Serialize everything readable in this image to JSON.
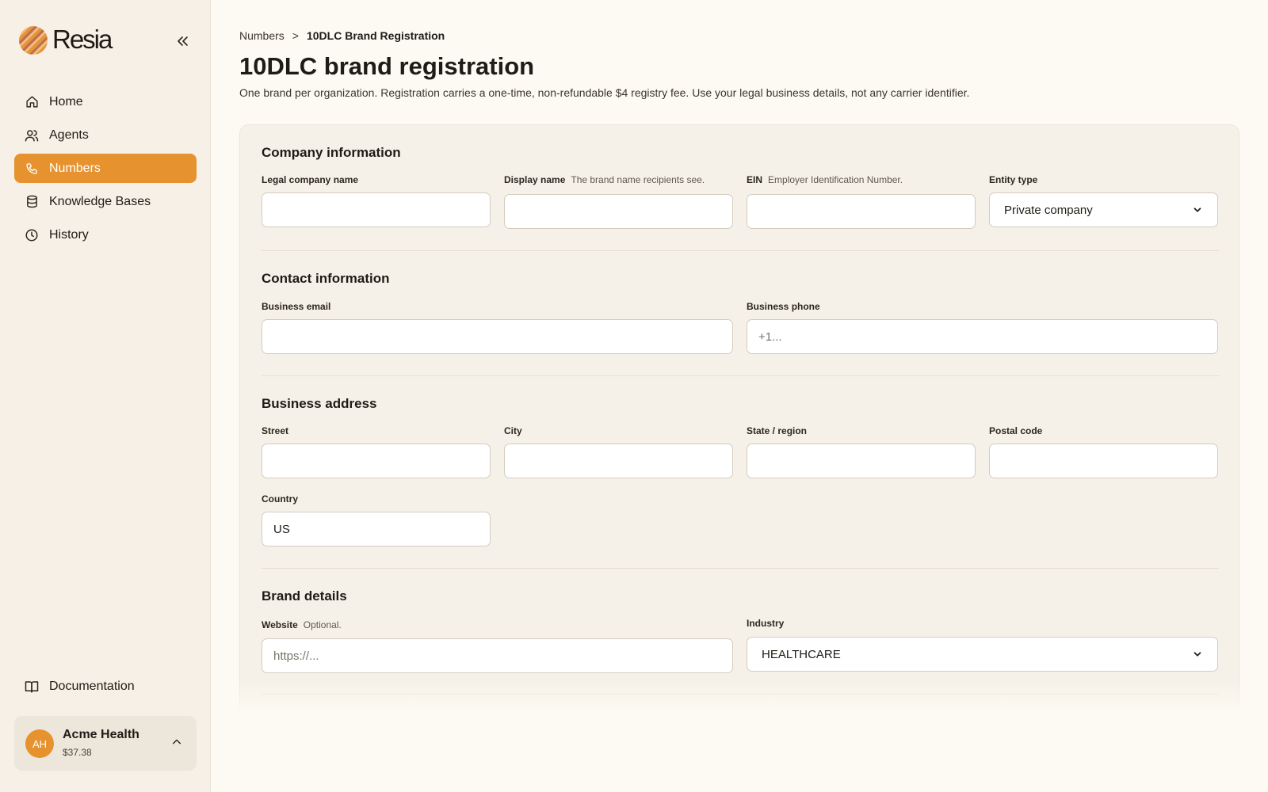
{
  "sidebar": {
    "logo_text": "Resia",
    "nav": [
      {
        "label": "Home",
        "icon": "home-icon"
      },
      {
        "label": "Agents",
        "icon": "users-icon"
      },
      {
        "label": "Numbers",
        "icon": "phone-icon",
        "active": true
      },
      {
        "label": "Knowledge Bases",
        "icon": "database-icon"
      },
      {
        "label": "History",
        "icon": "clock-icon"
      }
    ],
    "documentation_label": "Documentation",
    "account": {
      "initials": "AH",
      "name": "Acme Health",
      "balance": "$37.38"
    }
  },
  "breadcrumb": {
    "parent": "Numbers",
    "separator": ">",
    "current": "10DLC Brand Registration"
  },
  "page": {
    "title": "10DLC brand registration",
    "description": "One brand per organization. Registration carries a one-time, non-refundable $4 registry fee. Use your legal business details, not any carrier identifier."
  },
  "form": {
    "company": {
      "title": "Company information",
      "legal_name_label": "Legal company name",
      "display_name_label": "Display name",
      "display_name_hint": "The brand name recipients see.",
      "ein_label": "EIN",
      "ein_hint": "Employer Identification Number.",
      "entity_type_label": "Entity type",
      "entity_type_value": "Private company"
    },
    "contact": {
      "title": "Contact information",
      "email_label": "Business email",
      "phone_label": "Business phone",
      "phone_placeholder": "+1..."
    },
    "address": {
      "title": "Business address",
      "street_label": "Street",
      "city_label": "City",
      "state_label": "State / region",
      "postal_label": "Postal code",
      "country_label": "Country",
      "country_value": "US"
    },
    "brand": {
      "title": "Brand details",
      "website_label": "Website",
      "website_hint": "Optional.",
      "website_placeholder": "https://...",
      "industry_label": "Industry",
      "industry_value": "HEALTHCARE"
    }
  },
  "colors": {
    "accent": "#e6922f",
    "background": "#fdfaf3",
    "sidebar": "#f6f0e6",
    "card": "#f6f1e8"
  }
}
